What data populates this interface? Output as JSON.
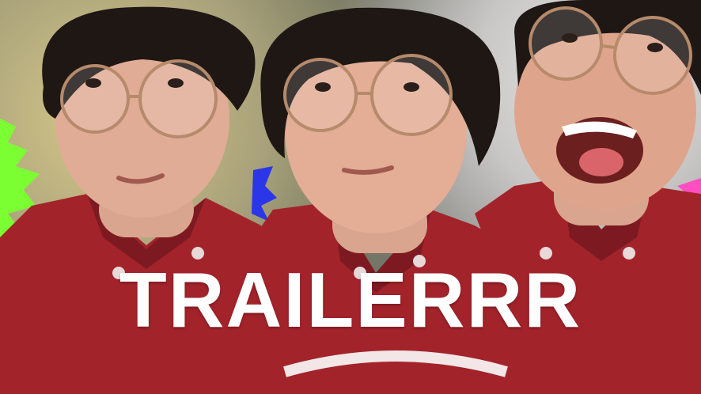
{
  "title_text": "TRAILERRR",
  "colors": {
    "hoodie": "#a3232b",
    "skin": "#d9a58f",
    "hair": "#1e1714",
    "glasses_frame": "#b68a6a",
    "text": "#ffffff"
  }
}
